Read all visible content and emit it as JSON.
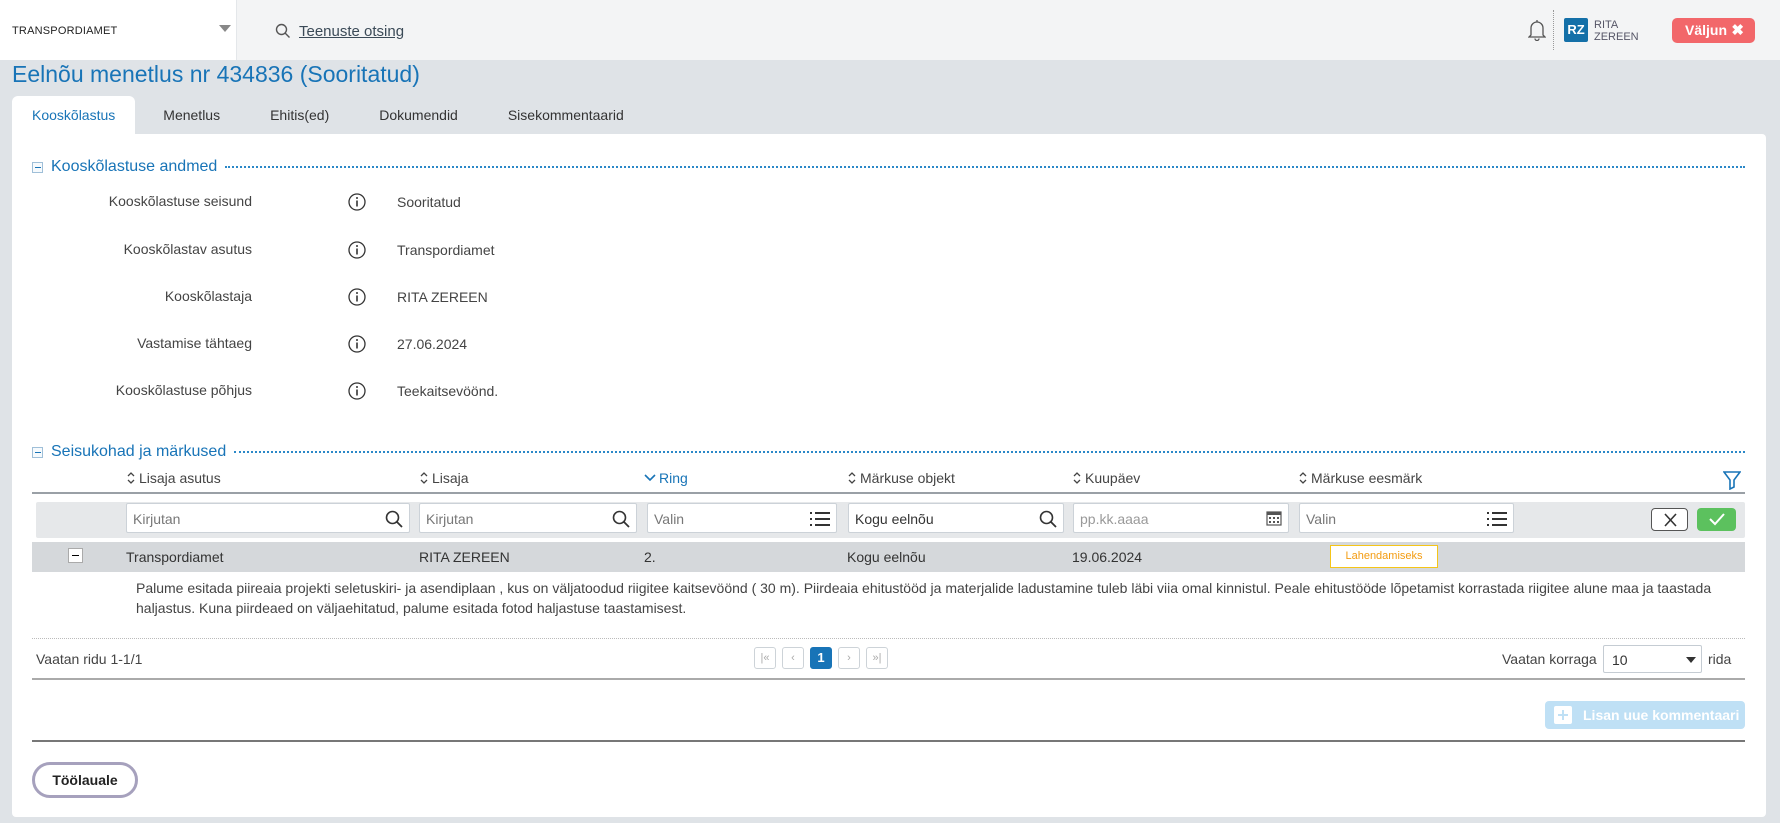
{
  "header": {
    "organization": "TRANSPORDIAMET",
    "search_label": "Teenuste otsing",
    "user_initials": "RZ",
    "user_first": "RITA",
    "user_last": "ZEREEN",
    "logout_label": "Väljun",
    "logout_icon": "close-icon"
  },
  "page": {
    "title": "Eelnõu menetlus nr 434836 (Sooritatud)"
  },
  "tabs": [
    "Kooskõlastus",
    "Menetlus",
    "Ehitis(ed)",
    "Dokumendid",
    "Sisekommentaarid"
  ],
  "active_tab": "Kooskõlastus",
  "section1": {
    "title": "Kooskõlastuse andmed",
    "fields": [
      {
        "label": "Kooskõlastuse seisund",
        "value": "Sooritatud"
      },
      {
        "label": "Kooskõlastav asutus",
        "value": "Transpordiamet"
      },
      {
        "label": "Kooskõlastaja",
        "value": "RITA ZEREEN"
      },
      {
        "label": "Vastamise tähtaeg",
        "value": "27.06.2024"
      },
      {
        "label": "Kooskõlastuse põhjus",
        "value": "Teekaitsevöönd."
      }
    ]
  },
  "section2": {
    "title": "Seisukohad ja märkused",
    "columns": [
      "Lisaja asutus",
      "Lisaja",
      "Ring",
      "Märkuse objekt",
      "Kuupäev",
      "Märkuse eesmärk"
    ],
    "sorted_column": "Ring",
    "filters": {
      "lisaja_asutus": "Kirjutan",
      "lisaja": "Kirjutan",
      "ring": "Valin",
      "markuse_objekt": "Kogu eelnõu",
      "kuupaev": "pp.kk.aaaa",
      "eesmark": "Valin"
    },
    "rows": [
      {
        "lisaja_asutus": "Transpordiamet",
        "lisaja": "RITA ZEREEN",
        "ring": "2.",
        "markuse_objekt": "Kogu eelnõu",
        "kuupaev": "19.06.2024",
        "eesmark": "Lahendamiseks",
        "comment": "Palume esitada piireaia projekti seletuskiri- ja asendiplaan , kus on väljatoodud riigitee kaitsevöönd ( 30 m).  Piirdeaia ehitustööd ja materjalide ladustamine  tuleb läbi viia omal kinnistul. Peale ehitustööde lõpetamist korrastada riigitee alune maa ja taastada haljastus. Kuna piirdeaed on väljaehitatud, palume esitada fotod haljastuse taastamisest."
      }
    ],
    "row_summary": "Vaatan ridu 1-1/1",
    "current_page": "1",
    "page_first": "|«",
    "page_prev": "‹",
    "page_next": "›",
    "page_last": "»|",
    "page_size_label": "Vaatan korraga",
    "page_size": "10",
    "page_size_suffix": "rida",
    "add_comment_label": "Lisan uue kommentaari"
  },
  "footer": {
    "back_label": "Töölauale"
  },
  "colors": {
    "accent": "#1874b7",
    "logout": "#f2676a",
    "badge_border": "#f5c518",
    "ok": "#5cc15e"
  }
}
